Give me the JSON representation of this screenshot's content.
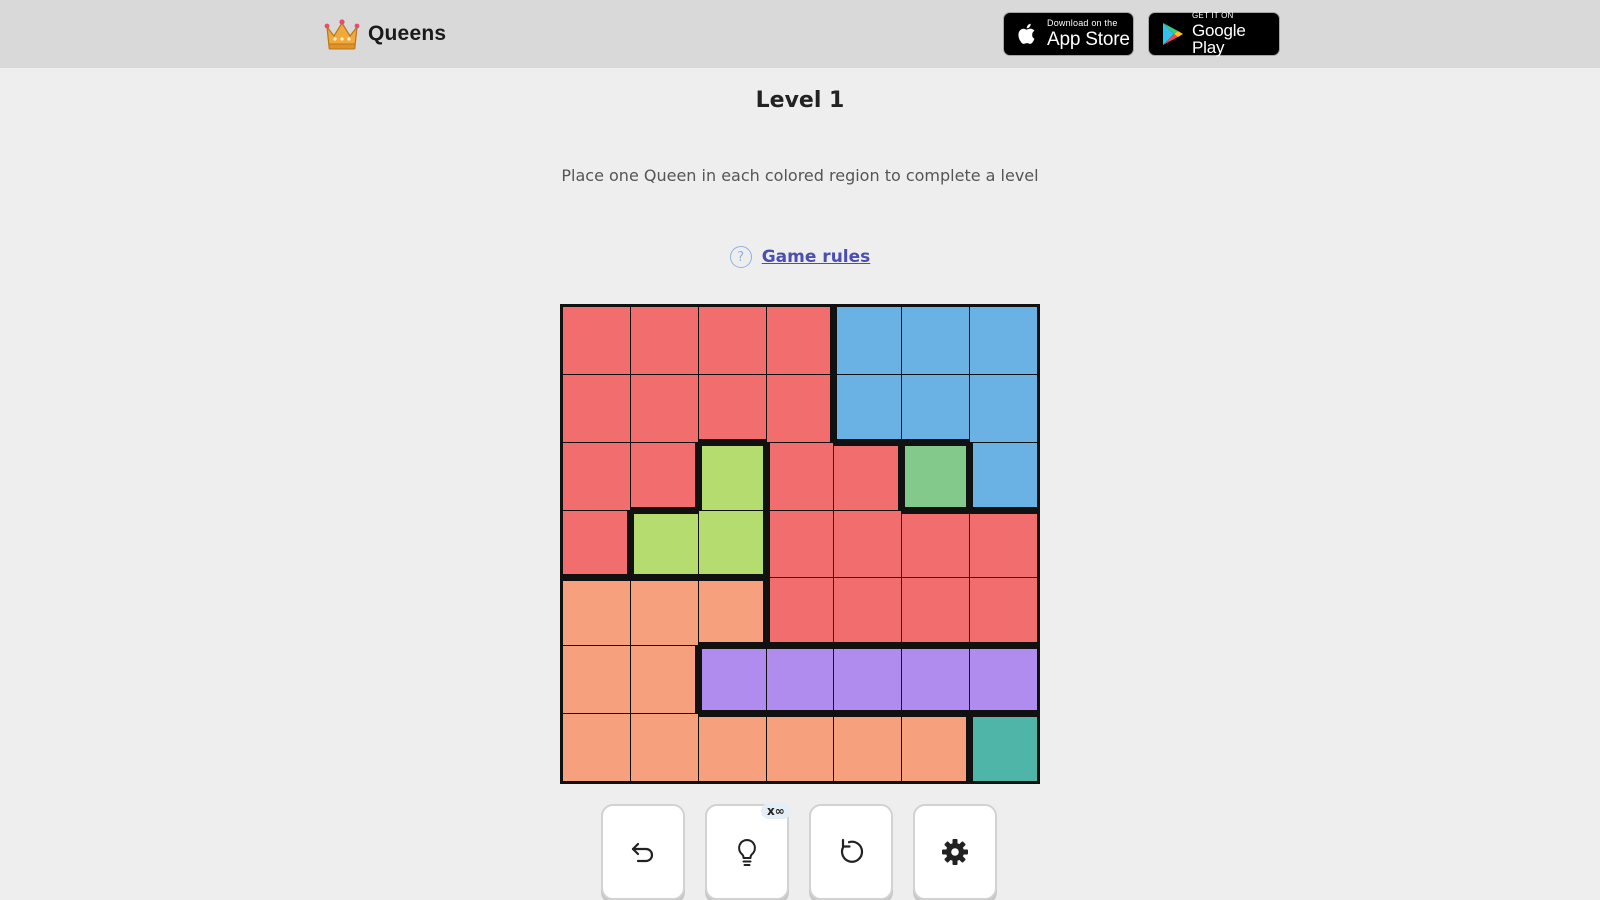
{
  "header": {
    "brand_name": "Queens",
    "logo_icon": "crown-icon",
    "app_store": {
      "small": "Download on the",
      "big": "App Store"
    },
    "google_play": {
      "small": "GET IT ON",
      "big": "Google Play"
    }
  },
  "level": {
    "title": "Level 1"
  },
  "instructions": "Place one Queen in each colored region to complete a level",
  "rules": {
    "icon": "question-circle-icon",
    "label": "Game rules"
  },
  "board": {
    "size": 7,
    "region_colors": {
      "red": "#f26d6d",
      "blue": "#6ab2e3",
      "lime": "#b5dc6e",
      "green": "#83c98c",
      "orange": "#f6a07e",
      "purple": "#b18cef",
      "teal": "#4fb5a8"
    },
    "grid": [
      [
        "red",
        "red",
        "red",
        "red",
        "blue",
        "blue",
        "blue"
      ],
      [
        "red",
        "red",
        "red",
        "red",
        "blue",
        "blue",
        "blue"
      ],
      [
        "red",
        "red",
        "lime",
        "red",
        "red",
        "green",
        "blue"
      ],
      [
        "red",
        "lime",
        "lime",
        "red",
        "red",
        "red",
        "red"
      ],
      [
        "orange",
        "orange",
        "orange",
        "red",
        "red",
        "red",
        "red"
      ],
      [
        "orange",
        "orange",
        "purple",
        "purple",
        "purple",
        "purple",
        "purple"
      ],
      [
        "orange",
        "orange",
        "orange",
        "orange",
        "orange",
        "orange",
        "teal"
      ]
    ]
  },
  "controls": {
    "undo_icon": "undo-icon",
    "hint_icon": "lightbulb-icon",
    "hint_badge": "x∞",
    "restart_icon": "restart-icon",
    "settings_icon": "gear-icon"
  }
}
